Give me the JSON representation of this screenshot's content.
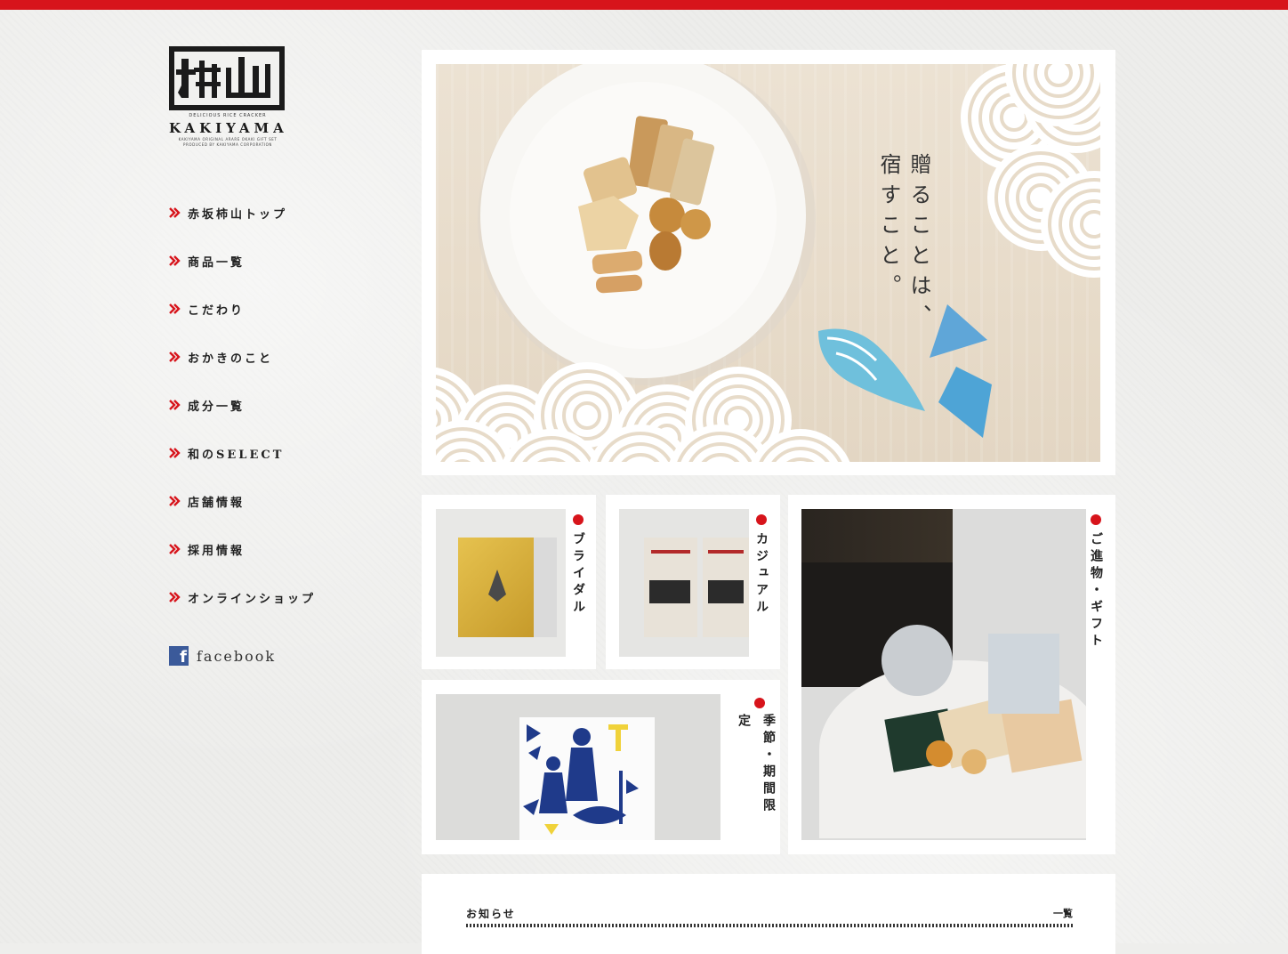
{
  "brand": {
    "logo_tagline": "DELICIOUS RICE CRACKER",
    "logo_name": "KAKIYAMA",
    "logo_subtitle": "KAKIYAMA ORIGINAL ARARE OKAKI GIFT SET",
    "logo_footer": "PRODUCED BY KAKIYAMA CORPORATION"
  },
  "colors": {
    "accent": "#d7141b",
    "facebook": "#3b5a9a"
  },
  "nav": {
    "items": [
      {
        "label": "赤坂柿山トップ"
      },
      {
        "label": "商品一覧"
      },
      {
        "label": "こだわり"
      },
      {
        "label": "おかきのこと"
      },
      {
        "label": "成分一覧"
      },
      {
        "label": "和のSELECT"
      },
      {
        "label": "店舗情報"
      },
      {
        "label": "採用情報"
      },
      {
        "label": "オンラインショップ"
      }
    ],
    "facebook_label": "facebook",
    "facebook_glyph": "f"
  },
  "hero": {
    "line1": "贈ることは、",
    "line2": "宿すこと。"
  },
  "categories": {
    "bridal": "ブライダル",
    "casual": "カジュアル",
    "gift": "ご進物・ギフト",
    "seasonal": "季節・期間限定"
  },
  "news": {
    "title": "お知らせ",
    "more": "一覧"
  }
}
